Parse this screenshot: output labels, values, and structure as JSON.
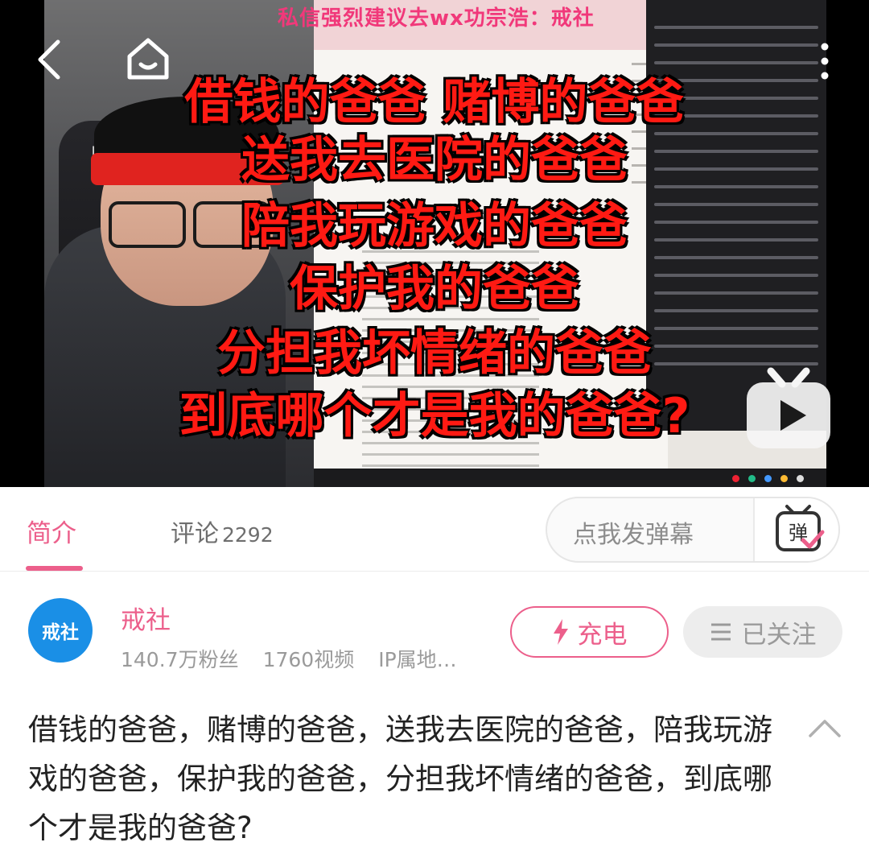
{
  "video": {
    "banner_text": "私信强烈建议去wx功宗浩：戒社",
    "subtitles": [
      "借钱的爸爸 赌博的爸爸",
      "送我去医院的爸爸",
      "陪我玩游戏的爸爸",
      "保护我的爸爸",
      "分担我坏情绪的爸爸",
      "到底哪个才是我的爸爸?"
    ],
    "icons": {
      "back": "chevron-left-icon",
      "home": "home-icon",
      "more": "more-vertical-icon",
      "badge": "bilibili-tv-play-icon"
    }
  },
  "tabs": {
    "intro_label": "简介",
    "comments_label": "评论",
    "comments_count": "2292",
    "danmaku_placeholder": "点我发弹幕",
    "danmaku_icon_text": "弹"
  },
  "uploader": {
    "avatar_text": "戒社",
    "name": "戒社",
    "fans": "140.7万粉丝",
    "videos": "1760视频",
    "ip": "IP属地…",
    "charge_label": "充电",
    "follow_label": "已关注"
  },
  "title": "借钱的爸爸，赌博的爸爸，送我去医院的爸爸，陪我玩游戏的爸爸，保护我的爸爸，分担我坏情绪的爸爸，到底哪个才是我的爸爸?",
  "colors": {
    "accent": "#ec5f8b",
    "subtitle": "#ff1a13",
    "avatar_bg": "#1a8fe6"
  }
}
